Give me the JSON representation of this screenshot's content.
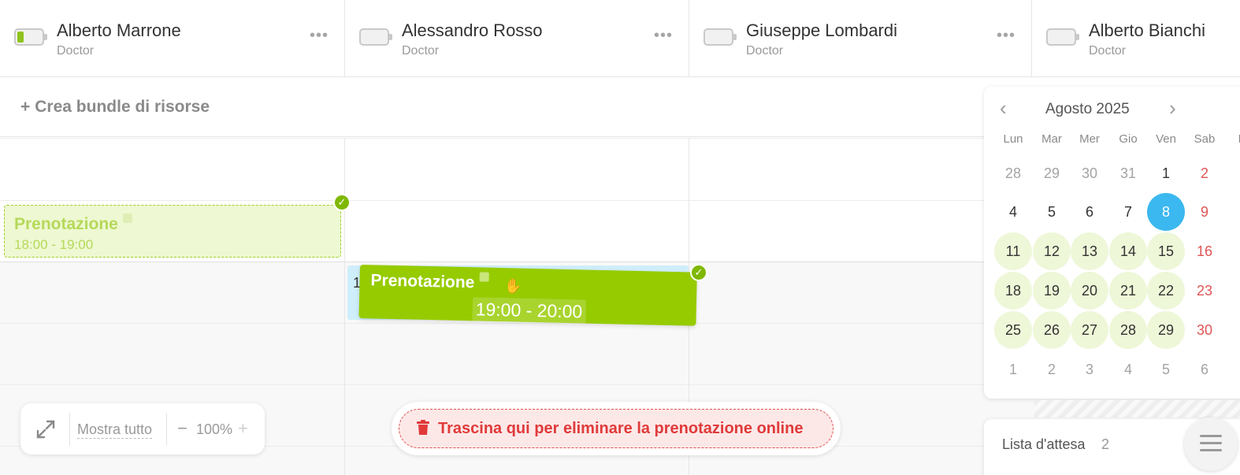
{
  "resources": [
    {
      "name": "Alberto Marrone",
      "role": "Doctor",
      "battery": "partial"
    },
    {
      "name": "Alessandro Rosso",
      "role": "Doctor",
      "battery": "empty"
    },
    {
      "name": "Giuseppe Lombardi",
      "role": "Doctor",
      "battery": "empty"
    },
    {
      "name": "Alberto Bianchi",
      "role": "Doctor",
      "battery": "empty"
    }
  ],
  "more_label": "•••",
  "bundle": {
    "plus": "+",
    "label": "Crea bundle di risorse"
  },
  "appointments": {
    "first": {
      "title": "Prenotazione",
      "time": "18:00 - 19:00"
    },
    "ghost_number": "1",
    "dragging": {
      "title": "Prenotazione",
      "time": "19:00 - 20:00"
    }
  },
  "calendar": {
    "prev": "‹",
    "next": "›",
    "month": "Agosto 2025",
    "weekdays": [
      "Lun",
      "Mar",
      "Mer",
      "Gio",
      "Ven",
      "Sab",
      "D"
    ],
    "weeks": [
      [
        "28",
        "29",
        "30",
        "31",
        "1",
        "2"
      ],
      [
        "4",
        "5",
        "6",
        "7",
        "8",
        "9"
      ],
      [
        "11",
        "12",
        "13",
        "14",
        "15",
        "16"
      ],
      [
        "18",
        "19",
        "20",
        "21",
        "22",
        "23"
      ],
      [
        "25",
        "26",
        "27",
        "28",
        "29",
        "30"
      ],
      [
        "1",
        "2",
        "3",
        "4",
        "5",
        "6"
      ]
    ],
    "selected_day": "8"
  },
  "waitlist": {
    "label": "Lista d'attesa",
    "count": "2"
  },
  "zoom": {
    "show_all": "Mostra tutto",
    "minus": "−",
    "value": "100%",
    "plus": "+"
  },
  "dropzone": {
    "label": "Trascina qui per eliminare la prenotazione online"
  },
  "colors": {
    "accent_green": "#96cb00",
    "selected_blue": "#3bb8ef",
    "weekend_red": "#e05555",
    "delete_red": "#e03a3a"
  }
}
